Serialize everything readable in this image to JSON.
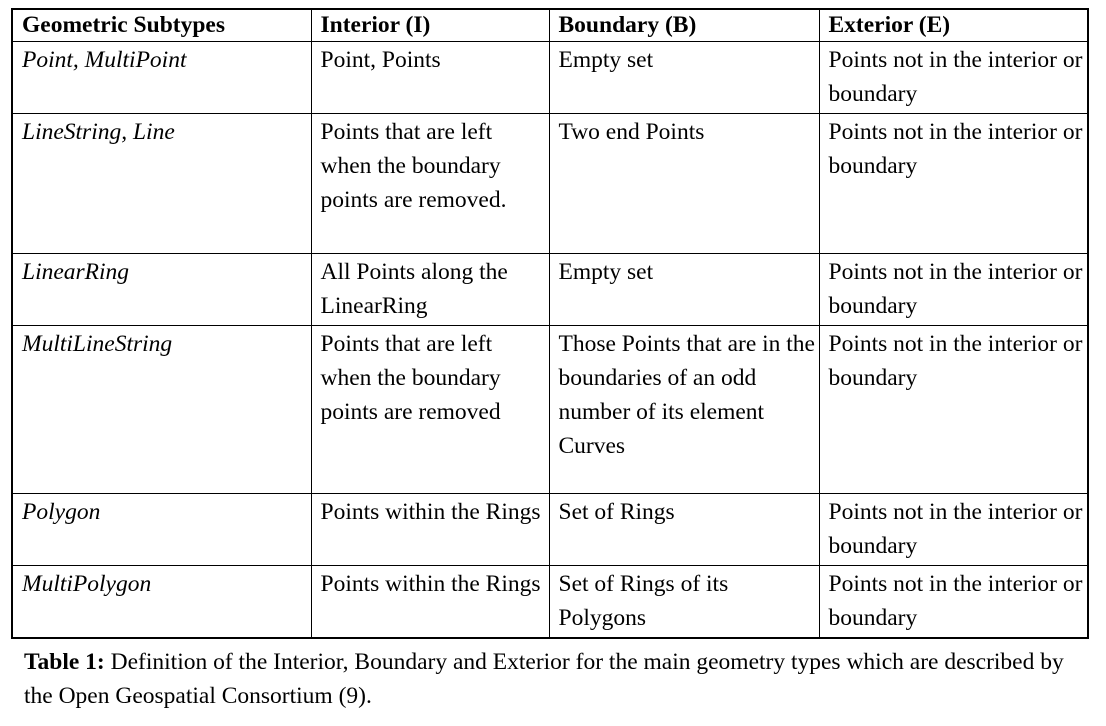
{
  "table": {
    "columns": [
      "Geometric Subtypes",
      "Interior (I)",
      "Boundary (B)",
      "Exterior (E)"
    ],
    "rows": [
      {
        "subtype": "Point, MultiPoint",
        "interior": "Point, Points",
        "boundary": "Empty set",
        "exterior": "Points not in the interior or boundary"
      },
      {
        "subtype": "LineString, Line",
        "interior": "Points that are left when the boundary points are removed.",
        "boundary": "Two end Points",
        "exterior": "Points not in the interior or boundary"
      },
      {
        "subtype": "LinearRing",
        "interior": "All Points along the LinearRing",
        "boundary": "Empty set",
        "exterior": "Points not in the interior or boundary"
      },
      {
        "subtype": "MultiLineString",
        "interior": "Points that are left when the boundary points are removed",
        "boundary": "Those Points that are in the boundaries of an odd number of its element Curves",
        "exterior": "Points not in the interior or boundary"
      },
      {
        "subtype": "Polygon",
        "interior": "Points within the Rings",
        "boundary": "Set of Rings",
        "exterior": "Points not in the interior or boundary"
      },
      {
        "subtype": "MultiPolygon",
        "interior": "Points within the Rings",
        "boundary": "Set of Rings of its Polygons",
        "exterior": "Points not in the interior or boundary"
      }
    ]
  },
  "caption": {
    "label": "Table 1:",
    "body": " Definition of the Interior, Boundary and Exterior for the main geometry types which are described by the Open Geospatial Consortium (9)."
  }
}
